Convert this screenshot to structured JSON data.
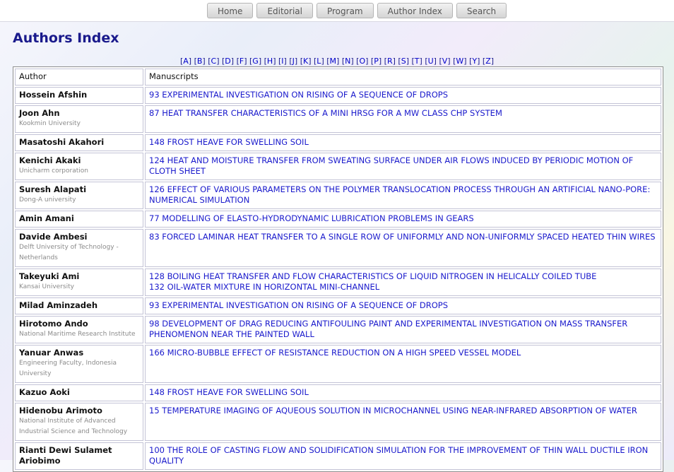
{
  "nav": {
    "items": [
      {
        "label": "Home"
      },
      {
        "label": "Editorial"
      },
      {
        "label": "Program"
      },
      {
        "label": "Author Index"
      },
      {
        "label": "Search"
      }
    ]
  },
  "page": {
    "title": "Authors Index"
  },
  "letters": [
    "A",
    "B",
    "C",
    "D",
    "F",
    "G",
    "H",
    "I",
    "J",
    "K",
    "L",
    "M",
    "N",
    "O",
    "P",
    "R",
    "S",
    "T",
    "U",
    "V",
    "W",
    "Y",
    "Z"
  ],
  "table": {
    "headers": {
      "author": "Author",
      "manuscripts": "Manuscripts"
    },
    "rows": [
      {
        "name": "Hossein Afshin",
        "affiliation": "",
        "manuscripts": [
          "93 EXPERIMENTAL INVESTIGATION ON RISING OF A SEQUENCE OF DROPS"
        ]
      },
      {
        "name": "Joon Ahn",
        "affiliation": "Kookmin University",
        "manuscripts": [
          "87 HEAT TRANSFER CHARACTERISTICS OF A MINI HRSG FOR A MW CLASS CHP SYSTEM"
        ]
      },
      {
        "name": "Masatoshi Akahori",
        "affiliation": "",
        "manuscripts": [
          "148 FROST HEAVE FOR SWELLING SOIL"
        ]
      },
      {
        "name": "Kenichi Akaki",
        "affiliation": "Unicharm corporation",
        "manuscripts": [
          "124 HEAT AND MOISTURE TRANSFER FROM SWEATING SURFACE UNDER AIR FLOWS INDUCED BY PERIODIC MOTION OF CLOTH SHEET"
        ]
      },
      {
        "name": "Suresh Alapati",
        "affiliation": "Dong-A university",
        "manuscripts": [
          "126 EFFECT OF VARIOUS PARAMETERS ON THE POLYMER TRANSLOCATION PROCESS THROUGH AN ARTIFICIAL NANO-PORE: NUMERICAL SIMULATION"
        ]
      },
      {
        "name": "Amin Amani",
        "affiliation": "",
        "manuscripts": [
          "77 MODELLING OF ELASTO-HYDRODYNAMIC LUBRICATION PROBLEMS IN GEARS"
        ]
      },
      {
        "name": "Davide Ambesi",
        "affiliation": "Delft University of Technology - Netherlands",
        "manuscripts": [
          "83 FORCED LAMINAR HEAT TRANSFER TO A SINGLE ROW OF UNIFORMLY AND NON-UNIFORMLY SPACED HEATED THIN WIRES"
        ]
      },
      {
        "name": "Takeyuki Ami",
        "affiliation": "Kansai University",
        "manuscripts": [
          "128 BOILING HEAT TRANSFER AND FLOW CHARACTERISTICS OF LIQUID NITROGEN IN HELICALLY COILED TUBE",
          "132 OIL-WATER MIXTURE IN HORIZONTAL MINI-CHANNEL"
        ]
      },
      {
        "name": "Milad Aminzadeh",
        "affiliation": "",
        "manuscripts": [
          "93 EXPERIMENTAL INVESTIGATION ON RISING OF A SEQUENCE OF DROPS"
        ]
      },
      {
        "name": "Hirotomo Ando",
        "affiliation": "National Maritime Research Institute",
        "manuscripts": [
          "98 DEVELOPMENT OF DRAG REDUCING ANTIFOULING PAINT AND EXPERIMENTAL INVESTIGATION ON MASS TRANSFER PHENOMENON NEAR THE PAINTED WALL"
        ]
      },
      {
        "name": "Yanuar Anwas",
        "affiliation": "Engineering Faculty, Indonesia University",
        "manuscripts": [
          "166 MICRO-BUBBLE EFFECT OF RESISTANCE REDUCTION ON A HIGH SPEED VESSEL MODEL"
        ]
      },
      {
        "name": "Kazuo Aoki",
        "affiliation": "",
        "manuscripts": [
          "148 FROST HEAVE FOR SWELLING SOIL"
        ]
      },
      {
        "name": "Hidenobu Arimoto",
        "affiliation": "National Institute of Advanced Industrial Science and Technology",
        "manuscripts": [
          "15 TEMPERATURE IMAGING OF AQUEOUS SOLUTION IN MICROCHANNEL USING NEAR-INFRARED ABSORPTION OF WATER"
        ]
      },
      {
        "name": "Rianti Dewi Sulamet Ariobimo",
        "affiliation": "",
        "manuscripts": [
          "100 THE ROLE OF CASTING FLOW AND SOLIDIFICATION SIMULATION FOR THE IMPROVEMENT OF THIN WALL DUCTILE IRON QUALITY"
        ]
      }
    ]
  }
}
